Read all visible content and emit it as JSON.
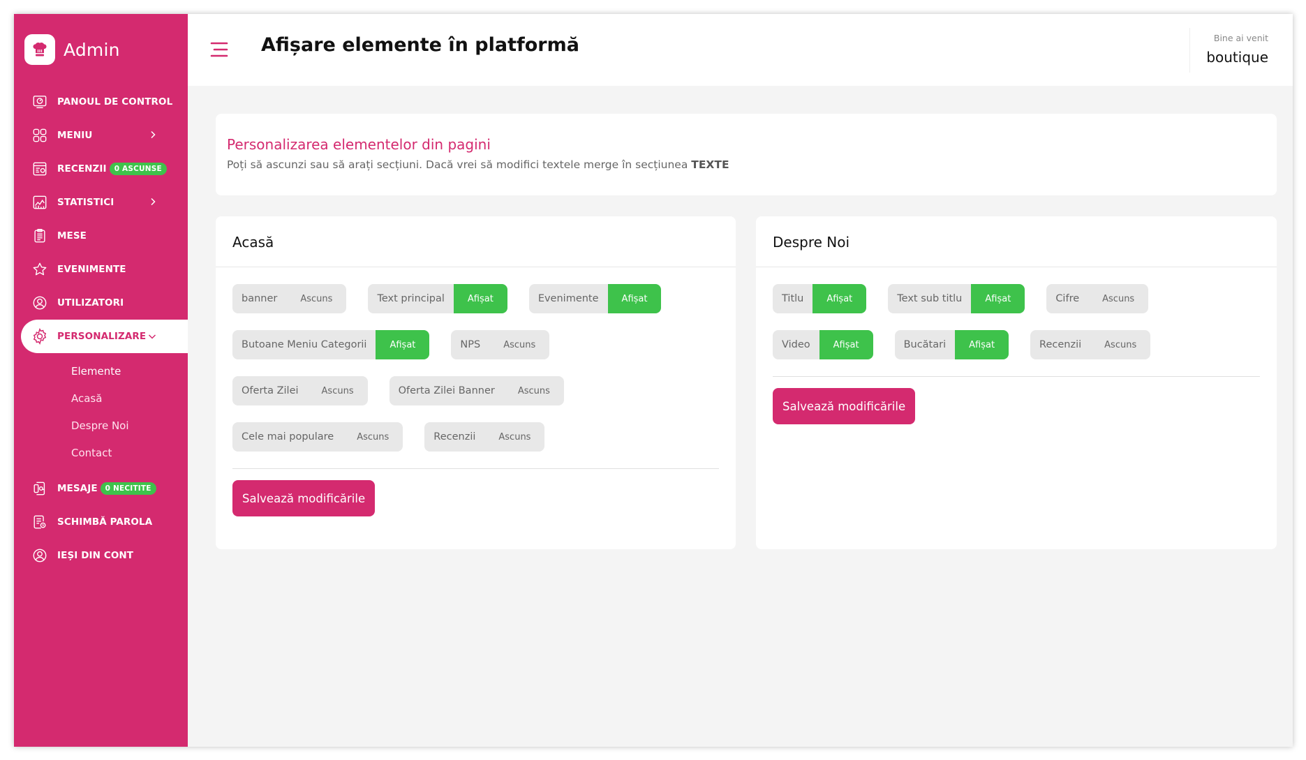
{
  "brand": {
    "name": "Admin",
    "logo_icon": "chef-hat-icon"
  },
  "colors": {
    "accent": "#d42a6f",
    "shown": "#3ec24b",
    "hidden": "#e8e8e8"
  },
  "sidebar": {
    "items": [
      {
        "label": "PANOUL DE CONTROL",
        "icon": "dashboard-icon"
      },
      {
        "label": "MENIU",
        "icon": "grid-icon",
        "has_chevron": true
      },
      {
        "label": "RECENZII",
        "icon": "reviews-icon",
        "badge": "0 ASCUNSE"
      },
      {
        "label": "STATISTICI",
        "icon": "chart-icon",
        "has_chevron": true
      },
      {
        "label": "MESE",
        "icon": "clipboard-icon"
      },
      {
        "label": "EVENIMENTE",
        "icon": "star-icon"
      },
      {
        "label": "UTILIZATORI",
        "icon": "user-icon"
      },
      {
        "label": "PERSONALIZARE",
        "icon": "gear-icon",
        "active": true,
        "expanded": true
      },
      {
        "label": "MESAJE",
        "icon": "message-icon",
        "badge": "0 NECITITE"
      },
      {
        "label": "SCHIMBĂ PAROLA",
        "icon": "document-icon"
      },
      {
        "label": "IEȘI DIN CONT",
        "icon": "logout-user-icon"
      }
    ],
    "sub_items": [
      {
        "label": "Elemente",
        "current": true
      },
      {
        "label": "Acasă"
      },
      {
        "label": "Despre Noi"
      },
      {
        "label": "Contact"
      }
    ]
  },
  "header": {
    "title": "Afișare elemente în platformă",
    "welcome_label": "Bine ai venit",
    "username": "boutique"
  },
  "intro": {
    "title": "Personalizarea elementelor din pagini",
    "description": "Poți să ascunzi sau să arați secțiuni. Dacă vrei să modifici textele merge în secțiunea",
    "description_bold": "TEXTE"
  },
  "panels": {
    "acasa": {
      "title": "Acasă",
      "save_label": "Salvează modificările",
      "rows": [
        [
          {
            "label": "banner",
            "status": "Ascuns"
          },
          {
            "label": "Text principal",
            "status": "Afișat"
          },
          {
            "label": "Evenimente",
            "status": "Afișat"
          }
        ],
        [
          {
            "label": "Butoane Meniu Categorii",
            "status": "Afișat"
          },
          {
            "label": "NPS",
            "status": "Ascuns"
          }
        ],
        [
          {
            "label": "Oferta Zilei",
            "status": "Ascuns"
          },
          {
            "label": "Oferta Zilei Banner",
            "status": "Ascuns"
          }
        ],
        [
          {
            "label": "Cele mai populare",
            "status": "Ascuns"
          },
          {
            "label": "Recenzii",
            "status": "Ascuns"
          }
        ]
      ]
    },
    "despre": {
      "title": "Despre Noi",
      "save_label": "Salvează modificările",
      "rows": [
        [
          {
            "label": "Titlu",
            "status": "Afișat"
          },
          {
            "label": "Text sub titlu",
            "status": "Afișat"
          },
          {
            "label": "Cifre",
            "status": "Ascuns"
          }
        ],
        [
          {
            "label": "Video",
            "status": "Afișat"
          },
          {
            "label": "Bucătari",
            "status": "Afișat"
          },
          {
            "label": "Recenzii",
            "status": "Ascuns"
          }
        ]
      ]
    }
  }
}
